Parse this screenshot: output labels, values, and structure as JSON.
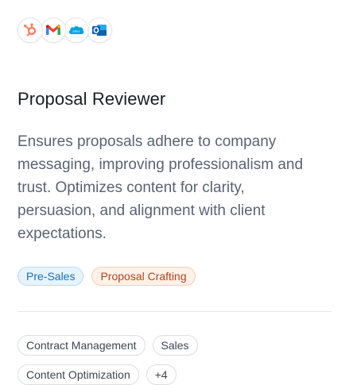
{
  "integrations": [
    {
      "name": "hubspot-icon",
      "color": "#ff7a59"
    },
    {
      "name": "gmail-icon",
      "color": "#ea4335"
    },
    {
      "name": "salesforce-icon",
      "color": "#00a1e0"
    },
    {
      "name": "outlook-icon",
      "color": "#0a64ad"
    }
  ],
  "title": "Proposal Reviewer",
  "description": "Ensures proposals adhere to company messaging, improving professionalism and trust. Optimizes content for clarity, persuasion, and alignment with client expectations.",
  "categories": [
    {
      "label": "Pre-Sales",
      "color": "#1c70b9"
    },
    {
      "label": "Proposal Crafting",
      "color": "#b3441c"
    }
  ],
  "skills": [
    "Contract Management",
    "Sales",
    "Content Optimization"
  ],
  "more_skills_label": "+4"
}
